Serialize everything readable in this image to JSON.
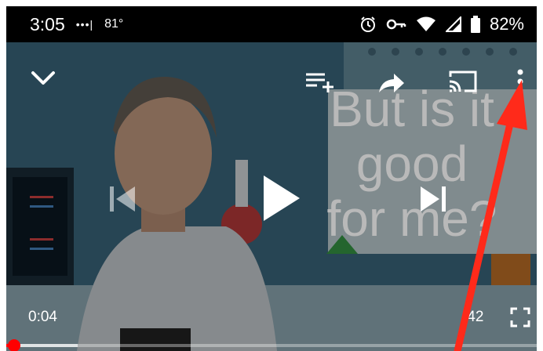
{
  "status_bar": {
    "time": "3:05",
    "signal_dots": "•••|",
    "temperature": "81°",
    "battery": "82%",
    "icons": [
      "alarm-icon",
      "vpn-key-icon",
      "wifi-icon",
      "cell-signal-icon",
      "battery-icon"
    ]
  },
  "player": {
    "caption_lines": [
      "But is it",
      "good",
      "for me?"
    ],
    "current_time": "0:04",
    "total_time": ":42",
    "progress": 0.015,
    "buffered": 0.135,
    "controls": [
      "minimize-chevron-icon",
      "add-to-queue-icon",
      "share-icon",
      "cast-icon",
      "more-options-icon",
      "previous-icon",
      "play-icon",
      "next-icon",
      "fullscreen-icon"
    ]
  },
  "annotation": {
    "color": "#ff2a1a"
  },
  "colors": {
    "progress": "#ff0000",
    "status_bg": "#000000"
  }
}
